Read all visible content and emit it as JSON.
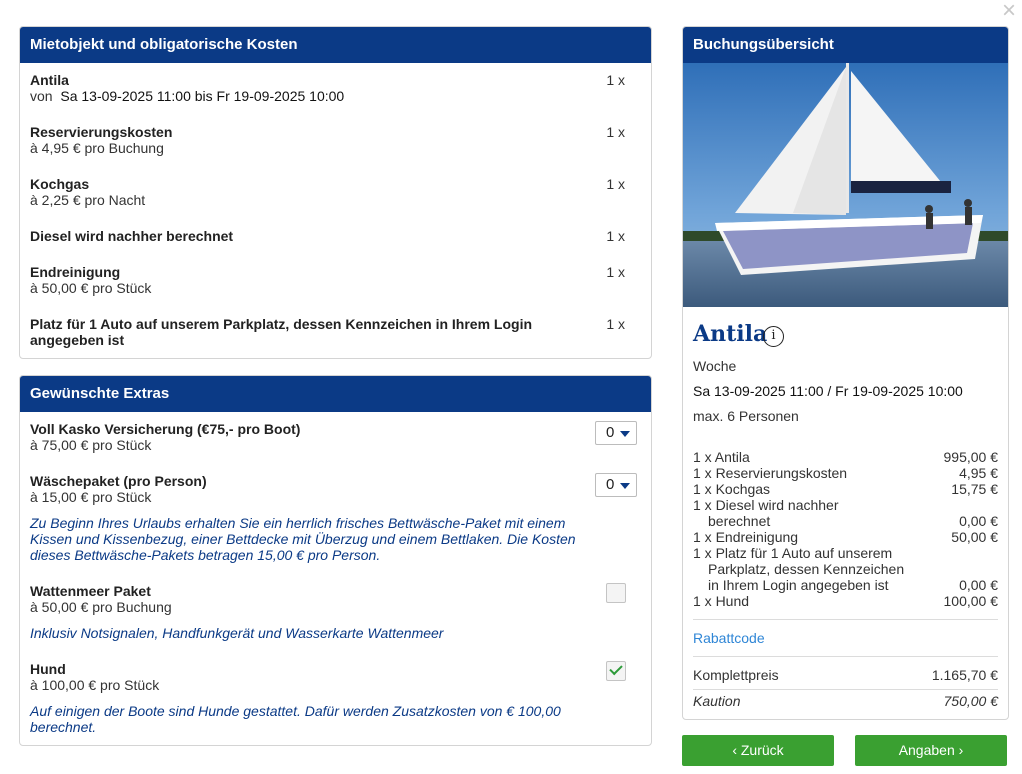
{
  "close_label": "×",
  "rental": {
    "header": "Mietobjekt und obligatorische Kosten",
    "items": [
      {
        "title": "Antila",
        "sub_prefix": "von",
        "sub": "Sa 13-09-2025 11:00 bis Fr 19-09-2025 10:00",
        "qty": "1 x"
      },
      {
        "title": "Reservierungskosten",
        "sub": "à 4,95 € pro Buchung",
        "qty": "1 x"
      },
      {
        "title": "Kochgas",
        "sub": "à 2,25 € pro Nacht",
        "qty": "1 x"
      },
      {
        "title": "Diesel wird nachher berechnet",
        "sub": "",
        "qty": "1 x"
      },
      {
        "title": "Endreinigung",
        "sub": "à 50,00 € pro Stück",
        "qty": "1 x"
      },
      {
        "title": "Platz für 1 Auto auf unserem Parkplatz, dessen Kennzeichen in Ihrem Login angegeben ist",
        "sub": "",
        "qty": "1 x"
      }
    ]
  },
  "extras": {
    "header": "Gewünschte Extras",
    "items": [
      {
        "title": "Voll Kasko Versicherung (€75,- pro Boot)",
        "sub": "à 75,00 € pro Stück",
        "value": "0"
      },
      {
        "title": "Wäschepaket (pro Person)",
        "sub": "à 15,00 € pro Stück",
        "value": "0",
        "desc": "Zu Beginn Ihres Urlaubs erhalten Sie ein herrlich frisches Bettwäsche-Paket mit einem Kissen und Kissenbezug, einer Bettdecke mit Überzug und einem Bettlaken. Die Kosten dieses Bettwäsche-Pakets betragen 15,00 € pro Person."
      },
      {
        "title": "Wattenmeer Paket",
        "sub": "à 50,00 € pro Buchung",
        "checked": false,
        "desc": "Inklusiv Notsignalen, Handfunkgerät und Wasserkarte Wattenmeer"
      },
      {
        "title": "Hund",
        "sub": "à 100,00 € pro Stück",
        "checked": true,
        "desc": "Auf einigen der Boote sind Hunde gestattet. Dafür werden Zusatzkosten von € 100,00 berechnet."
      }
    ]
  },
  "summary": {
    "header": "Buchungsübersicht",
    "boat_name": "Antila",
    "info_icon": "i",
    "period_type": "Woche",
    "dates": "Sa 13-09-2025 11:00 / Fr 19-09-2025 10:00",
    "persons": "max. 6 Personen",
    "costs": [
      {
        "label": "1 x Antila",
        "amount": "995,00  €"
      },
      {
        "label": "1 x Reservierungskosten",
        "amount": "4,95  €"
      },
      {
        "label": "1 x Kochgas",
        "amount": "15,75  €"
      },
      {
        "label": "1 x Diesel wird nachher",
        "cont": "berechnet",
        "amount": "0,00  €"
      },
      {
        "label": "1 x Endreinigung",
        "amount": "50,00  €"
      },
      {
        "label": "1 x Platz für 1 Auto auf unserem",
        "cont": "Parkplatz, dessen Kennzeichen",
        "cont2": "in Ihrem Login angegeben ist",
        "amount": "0,00  €"
      },
      {
        "label": "1 x Hund",
        "amount": "100,00  €"
      }
    ],
    "discount_link": "Rabattcode",
    "total_label": "Komplettpreis",
    "total_amount": "1.165,70  €",
    "deposit_label": "Kaution",
    "deposit_amount": "750,00  €"
  },
  "buttons": {
    "back": "‹ Zurück",
    "next": "Angaben ›"
  },
  "colors": {
    "header_bg": "#0b3a86",
    "button_bg": "#3aa031",
    "link": "#2f86d6"
  }
}
